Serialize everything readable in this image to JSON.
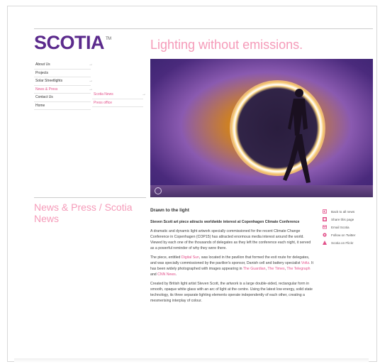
{
  "header": {
    "logo": "SCOTIA",
    "logo_mark": "TM",
    "tagline": "Lighting without emissions."
  },
  "nav": {
    "items": [
      {
        "label": "About Us",
        "has_arrow": true
      },
      {
        "label": "Projects",
        "has_arrow": false
      },
      {
        "label": "Solar Streetlights",
        "has_arrow": true
      },
      {
        "label": "News & Press",
        "has_arrow": true
      },
      {
        "label": "Contact Us",
        "has_arrow": false
      },
      {
        "label": "Home",
        "has_arrow": false
      }
    ],
    "arrow": "→",
    "subitems": [
      {
        "label": "Scotia News",
        "has_arrow": true
      },
      {
        "label": "Press office",
        "has_arrow": false
      }
    ]
  },
  "section_title": "News & Press / Scotia News",
  "article": {
    "heading": "Drawn to the light",
    "intro": "Steven Scott art piece attracts worldwide interest at Copenhagen Climate Conference",
    "p1": "A dramatic and dynamic light artwork specially commissioned for the recent Climate Change Conference in Copenhagen (COP15) has attracted enormous media interest around the world. Viewed by each one of the thousands of delegates as they left the conference each night, it served as a powerful reminder of why they were there.",
    "p2_a": "The piece, entitled ",
    "p2_link1": "Digital Sun",
    "p2_b": ", was located in the pavilion that formed the exit route for delegates, and was specially commissioned by the pavilion's sponsor, Danish cell and battery specialist ",
    "p2_link2": "Voltz",
    "p2_c": ". It has been widely photographed with images appearing in ",
    "p2_link3": "The Guardian",
    "p2_d": ", ",
    "p2_link4": "The Times",
    "p2_e": ", ",
    "p2_link5": "The Telegraph",
    "p2_f": " and ",
    "p2_link6": "CNN News",
    "p2_g": ".",
    "p3": "Created by British light artist Steven Scott, the artwork is a large double-sided, rectangular form in smooth, opaque white glass with an arc of light at the centre. Using the latest low energy, solid state technology, its three separate lighting elements operate independently of each other, creating a mesmerising interplay of colour."
  },
  "share": {
    "items": [
      {
        "label": "Back to all news",
        "icon": "back-icon",
        "color": "#e2508a"
      },
      {
        "label": "Share this page",
        "icon": "share-icon",
        "color": "#e2508a"
      },
      {
        "label": "Email Scotia",
        "icon": "email-icon",
        "color": "#e2508a"
      },
      {
        "label": "Follow on Twitter",
        "icon": "twitter-icon",
        "color": "#e2508a"
      },
      {
        "label": "Scotia on Flickr",
        "icon": "flickr-icon",
        "color": "#e2508a"
      }
    ]
  },
  "colors": {
    "brand": "#5b2a8c",
    "accent": "#e2508a",
    "tagline": "#f59bb9"
  }
}
